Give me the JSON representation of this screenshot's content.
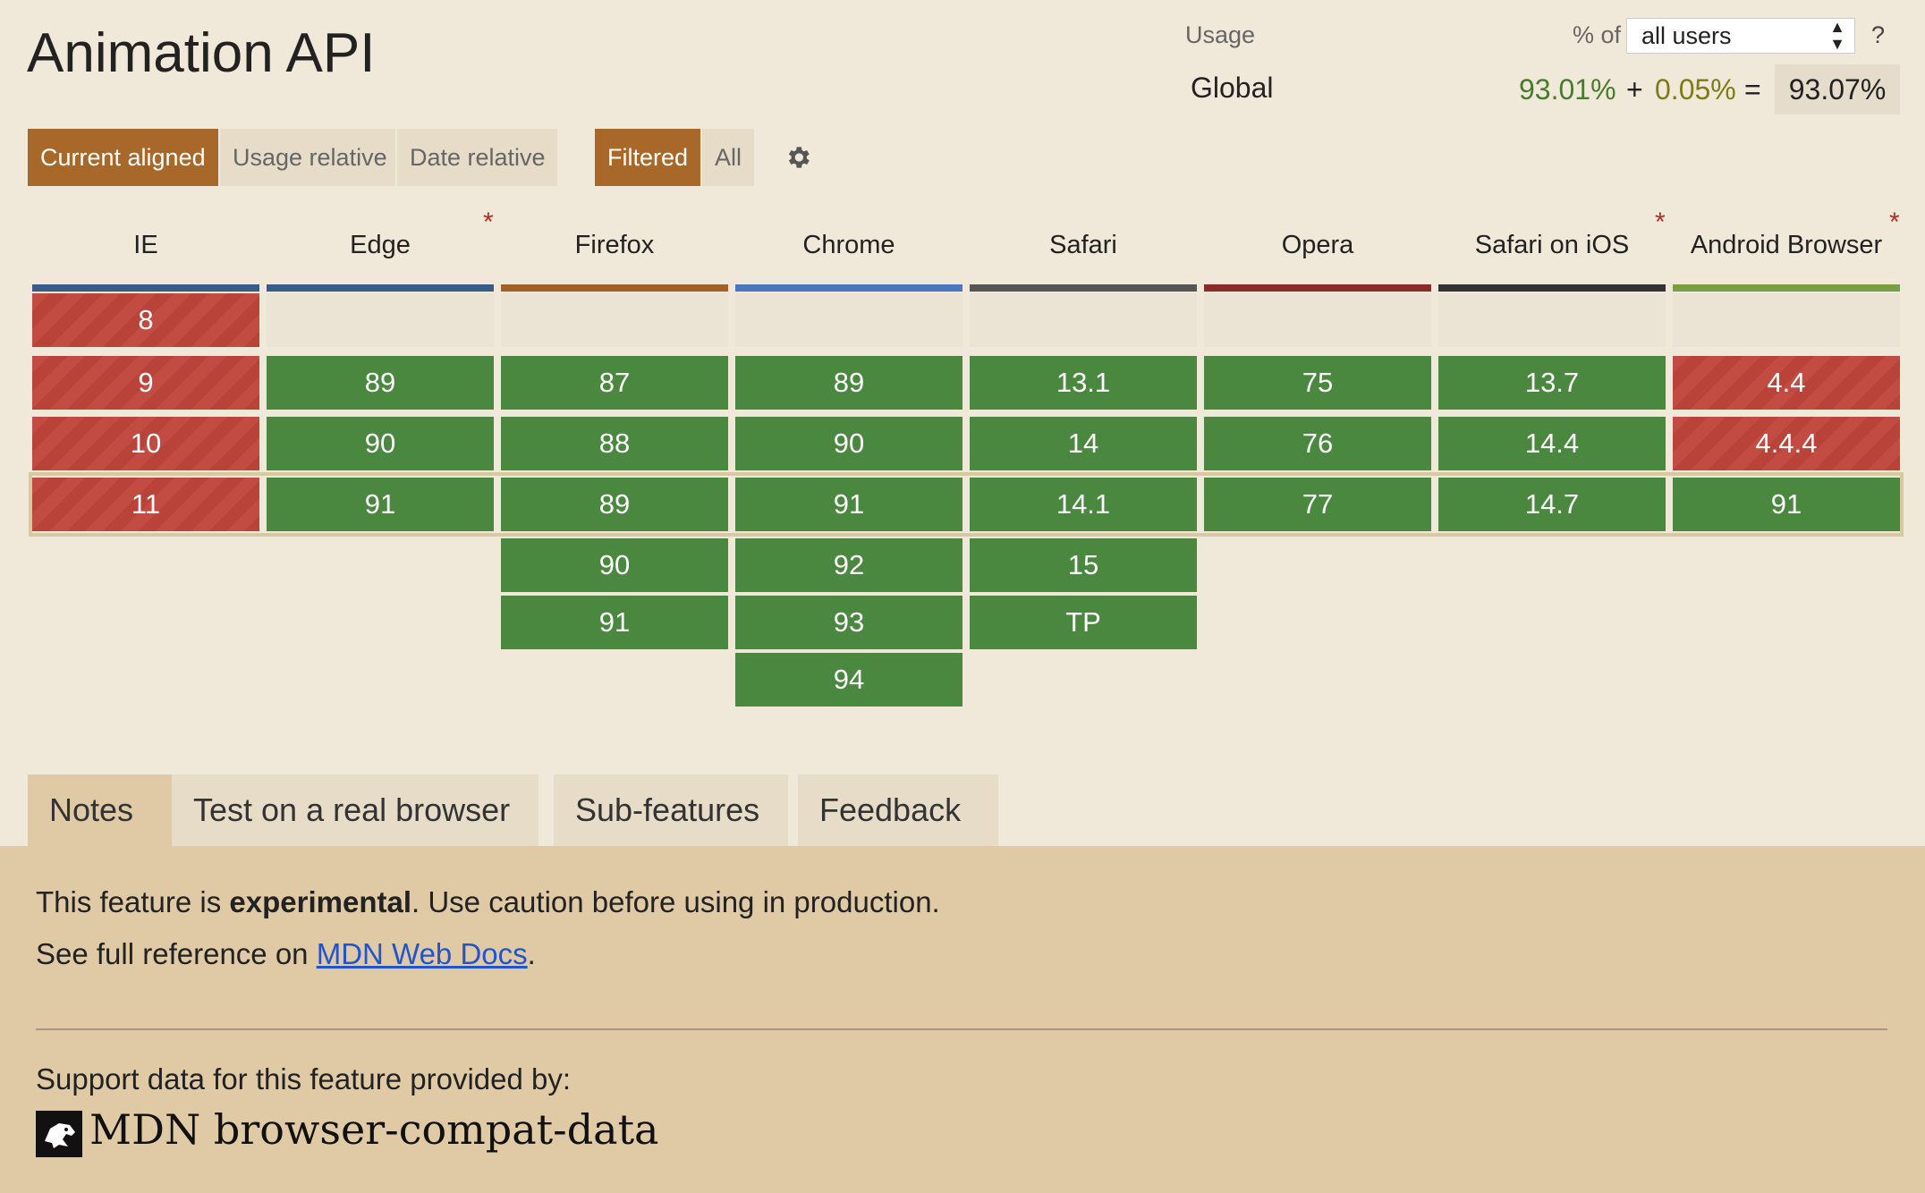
{
  "feature": {
    "title": "Animation API"
  },
  "usage": {
    "label": "Usage",
    "pct_of_label": "% of",
    "selected_scope": "all users",
    "help": "?",
    "region": "Global",
    "supported_pct": "93.01%",
    "plus": "+",
    "partial_pct": "0.05%",
    "equals": "=",
    "total_pct": "93.07%"
  },
  "view_modes": {
    "current_aligned": "Current aligned",
    "usage_relative": "Usage relative",
    "date_relative": "Date relative"
  },
  "filters": {
    "filtered": "Filtered",
    "all": "All"
  },
  "icons": {
    "settings": "gear-icon",
    "mdn_logo": "mdn-dino-icon"
  },
  "colors": {
    "supported": "#4a8840",
    "unsupported": "#c34c42",
    "accent": "#a8682a"
  },
  "browsers": [
    {
      "name": "IE",
      "asterisk": "",
      "color": "#3b5a8c"
    },
    {
      "name": "Edge",
      "asterisk": "*",
      "color": "#3b5a8c"
    },
    {
      "name": "Firefox",
      "asterisk": "",
      "color": "#a0622a"
    },
    {
      "name": "Chrome",
      "asterisk": "",
      "color": "#4a78c0"
    },
    {
      "name": "Safari",
      "asterisk": "",
      "color": "#555555"
    },
    {
      "name": "Opera",
      "asterisk": "",
      "color": "#8c2a2a"
    },
    {
      "name": "Safari on iOS",
      "asterisk": "*",
      "color": "#333333"
    },
    {
      "name": "Android Browser",
      "asterisk": "*",
      "color": "#78a040"
    }
  ],
  "support_table": {
    "IE": {
      "8": "unsupported",
      "9": "unsupported",
      "10": "unsupported",
      "11": "unsupported"
    },
    "versions": {
      "IE": [
        "8",
        "9",
        "10",
        "11"
      ],
      "Edge": [
        "89",
        "90",
        "91"
      ],
      "Firefox": [
        "87",
        "88",
        "89",
        "90",
        "91"
      ],
      "Chrome": [
        "89",
        "90",
        "91",
        "92",
        "93",
        "94"
      ],
      "Safari": [
        "13.1",
        "14",
        "14.1",
        "15",
        "TP"
      ],
      "Opera": [
        "75",
        "76",
        "77"
      ],
      "Safari on iOS": [
        "13.7",
        "14.4",
        "14.7"
      ],
      "Android Browser": [
        "4.4",
        "4.4.4",
        "91"
      ]
    },
    "status": {
      "IE": [
        "unsupported",
        "unsupported",
        "unsupported",
        "unsupported"
      ],
      "Edge": [
        "supported",
        "supported",
        "supported"
      ],
      "Firefox": [
        "supported",
        "supported",
        "supported",
        "supported",
        "supported"
      ],
      "Chrome": [
        "supported",
        "supported",
        "supported",
        "supported",
        "supported",
        "supported"
      ],
      "Safari": [
        "supported",
        "supported",
        "supported",
        "supported",
        "supported"
      ],
      "Opera": [
        "supported",
        "supported",
        "supported"
      ],
      "Safari on iOS": [
        "supported",
        "supported",
        "supported"
      ],
      "Android Browser": [
        "unsupported",
        "unsupported",
        "supported"
      ]
    }
  },
  "tabs": [
    "Notes",
    "Test on a real browser",
    "Sub-features",
    "Feedback"
  ],
  "notes": {
    "line1_prefix": "This feature is ",
    "line1_bold": "experimental",
    "line1_suffix": ". Use caution before using in production.",
    "line2_prefix": "See full reference on ",
    "line2_link": "MDN Web Docs",
    "line2_suffix": ".",
    "support_by": "Support data for this feature provided by:",
    "source_name": "MDN browser-compat-data"
  }
}
